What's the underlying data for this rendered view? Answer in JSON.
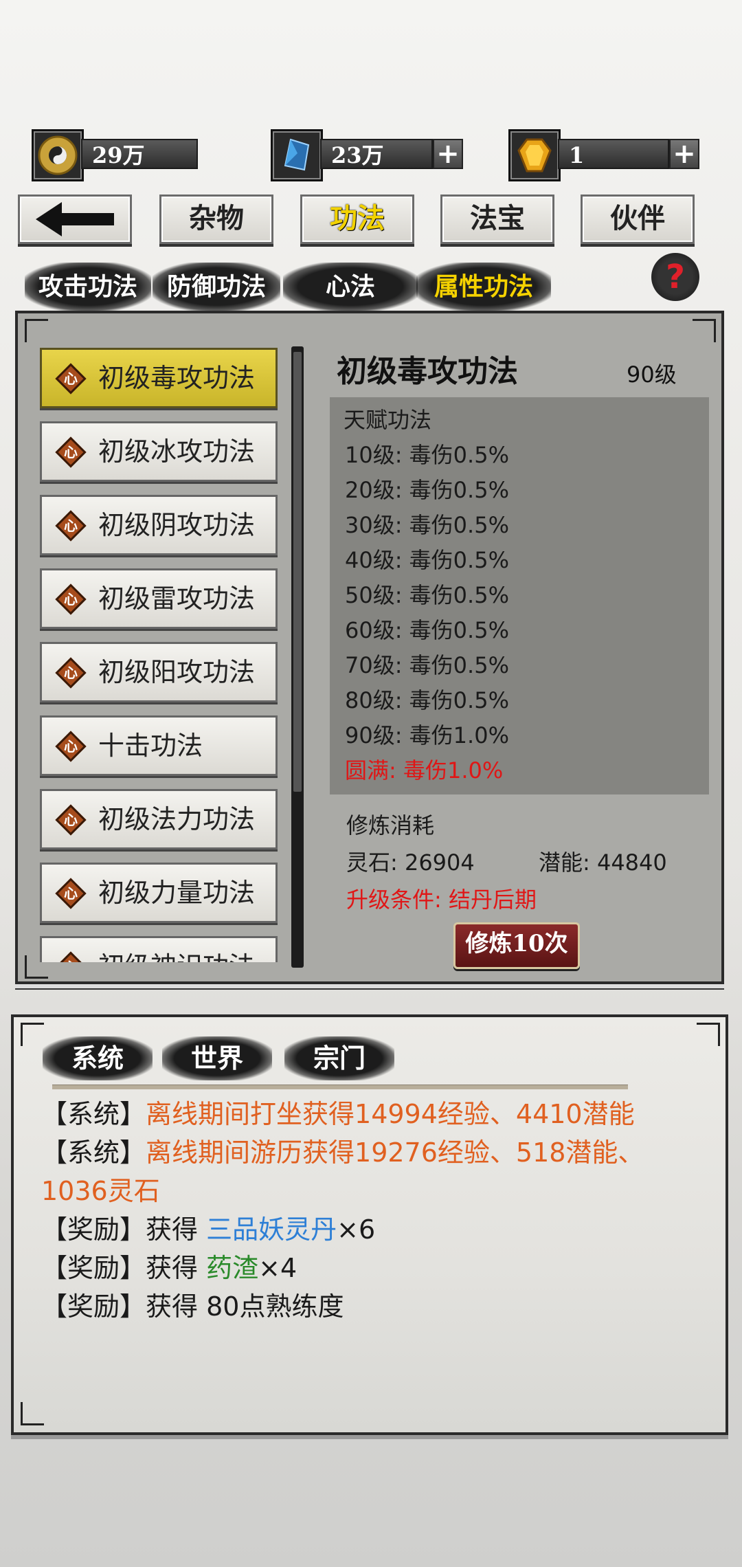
{
  "currencies": [
    {
      "icon": "yin-yang-icon",
      "value": "29万",
      "has_plus": false
    },
    {
      "icon": "blue-crystal-icon",
      "value": "23万",
      "has_plus": true
    },
    {
      "icon": "gold-gem-icon",
      "value": "1",
      "has_plus": true
    }
  ],
  "nav": {
    "back": "back-arrow-icon",
    "tabs": [
      "杂物",
      "功法",
      "法宝",
      "伙伴"
    ],
    "active": "功法"
  },
  "categories": {
    "items": [
      "攻击功法",
      "防御功法",
      "心法",
      "属性功法"
    ],
    "active": "属性功法",
    "help": "?"
  },
  "skill_list": [
    {
      "badge": "心",
      "name": "初级毒攻功法",
      "selected": true
    },
    {
      "badge": "心",
      "name": "初级冰攻功法"
    },
    {
      "badge": "心",
      "name": "初级阴攻功法"
    },
    {
      "badge": "心",
      "name": "初级雷攻功法"
    },
    {
      "badge": "心",
      "name": "初级阳攻功法"
    },
    {
      "badge": "心",
      "name": "十击功法"
    },
    {
      "badge": "心",
      "name": "初级法力功法"
    },
    {
      "badge": "心",
      "name": "初级力量功法"
    },
    {
      "badge": "心",
      "name": "初级神识功法"
    }
  ],
  "detail": {
    "title": "初级毒攻功法",
    "level": "90级",
    "talent_header": "天赋功法",
    "talents": [
      "10级: 毒伤0.5%",
      "20级: 毒伤0.5%",
      "30级: 毒伤0.5%",
      "40级: 毒伤0.5%",
      "50级: 毒伤0.5%",
      "60级: 毒伤0.5%",
      "70级: 毒伤0.5%",
      "80级: 毒伤0.5%",
      "90级: 毒伤1.0%"
    ],
    "complete": "圆满: 毒伤1.0%",
    "cost_header": "修炼消耗",
    "spirit_stone": "灵石: 26904",
    "potential": "潜能: 44840",
    "upgrade_cond": "升级条件: 结丹后期",
    "train_button": "修炼10次"
  },
  "chat": {
    "tabs": [
      "系统",
      "世界",
      "宗门"
    ],
    "lines": [
      {
        "tag": "【系统】",
        "text": "离线期间打坐获得14994经验、4410潜能"
      },
      {
        "tag": "【系统】",
        "text": "离线期间游历获得19276经验、518潜能、"
      },
      {
        "tag": "",
        "text": "1036灵石"
      },
      {
        "tag": "【奖励】",
        "prefix": "获得 ",
        "item": "三品妖灵丹",
        "suffix": "×6"
      },
      {
        "tag": "【奖励】",
        "prefix": "获得 ",
        "item": "药渣",
        "suffix": "×4"
      },
      {
        "tag": "【奖励】",
        "prefix": "获得 80点熟练度"
      }
    ]
  },
  "colors": {
    "selected": "#d4c239",
    "orange": "#e06020",
    "blue": "#2d7fd6",
    "green": "#2a8a2a",
    "red": "#e01616"
  }
}
